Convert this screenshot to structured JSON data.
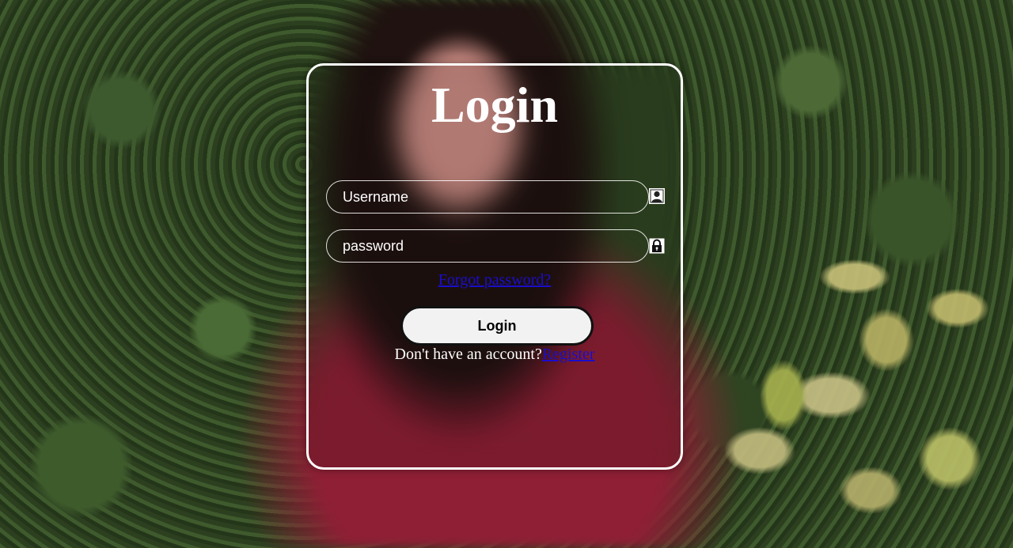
{
  "background": {
    "description_icon": "photo-background"
  },
  "login_form": {
    "title": "Login",
    "username_placeholder": "Username",
    "password_placeholder": "password",
    "user_icon": "user-icon",
    "lock_icon": "lock-icon",
    "forgot_password_text": "Forgot password?",
    "login_button_label": "Login",
    "no_account_text": "Don't have an account?",
    "register_link_text": "Register"
  },
  "colors": {
    "card_border": "#ffffff",
    "link": "#1a0dcc",
    "button_bg": "#f2f2f2",
    "text": "#ffffff"
  }
}
